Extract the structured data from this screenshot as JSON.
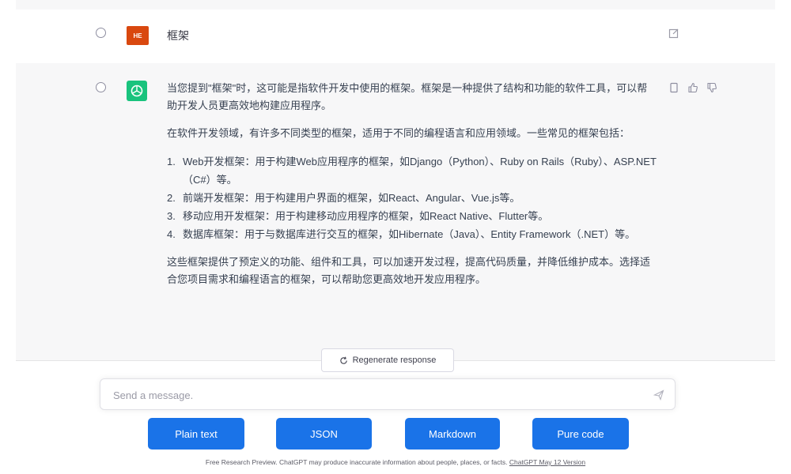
{
  "user_message": {
    "avatar_initials": "HE",
    "text": "框架"
  },
  "assistant_message": {
    "paragraphs": [
      "当您提到\"框架\"时，这可能是指软件开发中使用的框架。框架是一种提供了结构和功能的软件工具，可以帮助开发人员更高效地构建应用程序。",
      "在软件开发领域，有许多不同类型的框架，适用于不同的编程语言和应用领域。一些常见的框架包括："
    ],
    "list": [
      {
        "num": "1.",
        "text": "Web开发框架：用于构建Web应用程序的框架，如Django（Python）、Ruby on Rails（Ruby）、ASP.NET（C#）等。"
      },
      {
        "num": "2.",
        "text": "前端开发框架：用于构建用户界面的框架，如React、Angular、Vue.js等。"
      },
      {
        "num": "3.",
        "text": "移动应用开发框架：用于构建移动应用程序的框架，如React Native、Flutter等。"
      },
      {
        "num": "4.",
        "text": "数据库框架：用于与数据库进行交互的框架，如Hibernate（Java）、Entity Framework（.NET）等。"
      }
    ],
    "closing": "这些框架提供了预定义的功能、组件和工具，可以加速开发过程，提高代码质量，并降低维护成本。选择适合您项目需求和编程语言的框架，可以帮助您更高效地开发应用程序。"
  },
  "regenerate_label": "Regenerate response",
  "composer": {
    "placeholder": "Send a message."
  },
  "buttons": {
    "plain_text": "Plain text",
    "json": "JSON",
    "markdown": "Markdown",
    "pure_code": "Pure code"
  },
  "footer": {
    "text": "Free Research Preview. ChatGPT may produce inaccurate information about people, places, or facts.",
    "link": "ChatGPT May 12 Version"
  },
  "colors": {
    "user_avatar": "#d9480f",
    "bot_avatar": "#19c37d",
    "button": "#1a73e8"
  }
}
